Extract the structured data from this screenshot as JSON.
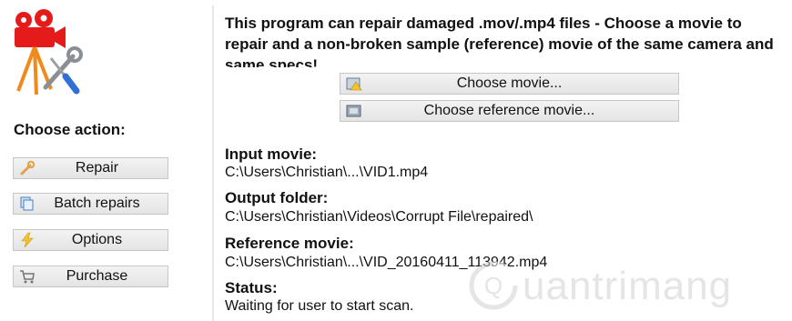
{
  "sidebar": {
    "choose_action_label": "Choose action:",
    "buttons": [
      {
        "label": "Repair",
        "icon": "wrench-icon"
      },
      {
        "label": "Batch repairs",
        "icon": "batch-icon"
      },
      {
        "label": "Options",
        "icon": "lightning-icon"
      },
      {
        "label": "Purchase",
        "icon": "cart-icon"
      }
    ]
  },
  "main": {
    "description": "This program can repair damaged .mov/.mp4 files - Choose a movie to repair and a non-broken sample (reference) movie of the same camera and same specs!",
    "choose_movie_label": "Choose movie...",
    "choose_reference_label": "Choose reference movie...",
    "fields": {
      "input_label": "Input movie:",
      "input_value": "C:\\Users\\Christian\\...\\VID1.mp4",
      "output_label": "Output folder:",
      "output_value": "C:\\Users\\Christian\\Videos\\Corrupt File\\repaired\\",
      "reference_label": "Reference movie:",
      "reference_value": "C:\\Users\\Christian\\...\\VID_20160411_113942.mp4",
      "status_label": "Status:",
      "status_value": "Waiting for user to start scan."
    }
  },
  "watermark": {
    "text": "uantrimang"
  },
  "colors": {
    "button_border": "#c6c6c6",
    "camera_red": "#e51a1a",
    "tripod_orange": "#f08a1c",
    "tool_blue": "#2f6fd6"
  }
}
